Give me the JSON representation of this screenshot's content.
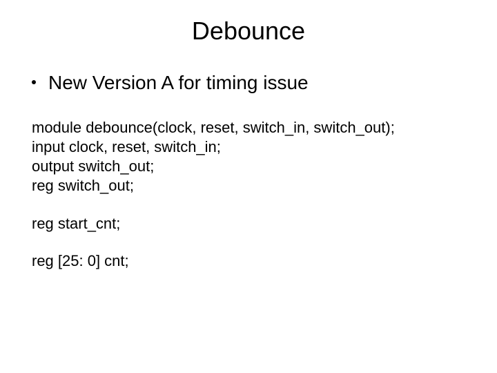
{
  "title": "Debounce",
  "bullet": "New Version A for timing issue",
  "code": {
    "l1": "module debounce(clock, reset, switch_in, switch_out);",
    "l2": "input clock, reset, switch_in;",
    "l3": "output switch_out;",
    "l4": "reg switch_out;",
    "l5": "reg start_cnt;",
    "l6": "reg [25: 0] cnt;"
  }
}
